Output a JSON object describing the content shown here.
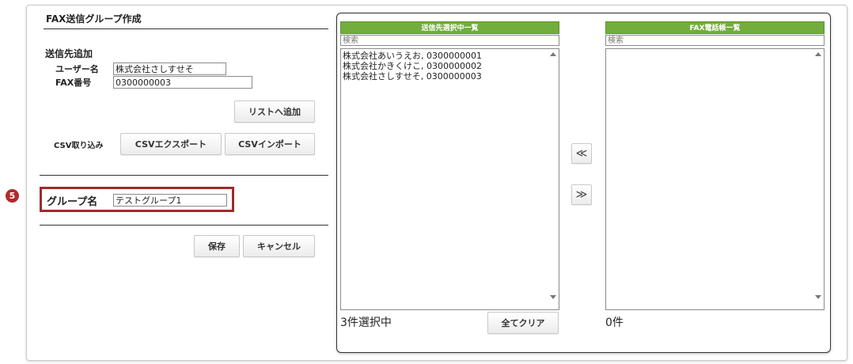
{
  "form": {
    "title": "FAX送信グループ作成",
    "section_title": "送信先追加",
    "user_label": "ユーザー名",
    "user_value": "株式会社さしすせそ",
    "fax_label": "FAX番号",
    "fax_value": "0300000003",
    "add_to_list_label": "リストへ追加",
    "csv_label": "CSV取り込み",
    "csv_export_label": "CSVエクスポート",
    "csv_import_label": "CSVインポート",
    "group_name_label": "グループ名",
    "group_name_value": "テストグループ1",
    "save_label": "保存",
    "cancel_label": "キャンセル"
  },
  "annotation": {
    "step_number": "5",
    "color": "#a12a2a"
  },
  "selected_list": {
    "header": "送信先選択中一覧",
    "search_placeholder": "検索",
    "items": [
      "株式会社あいうえお, 0300000001",
      "株式会社かきくけこ, 0300000002",
      "株式会社さしすせそ, 0300000003"
    ],
    "count_text": "3件選択中",
    "clear_all_label": "全てクリア"
  },
  "transfer": {
    "to_left": "≪",
    "to_right": "≫"
  },
  "phonebook_list": {
    "header": "FAX電話帳一覧",
    "search_placeholder": "検索",
    "items": [],
    "count_text": "0件"
  },
  "colors": {
    "header_green": "#72ad3d",
    "badge_red": "#b22a2a"
  }
}
